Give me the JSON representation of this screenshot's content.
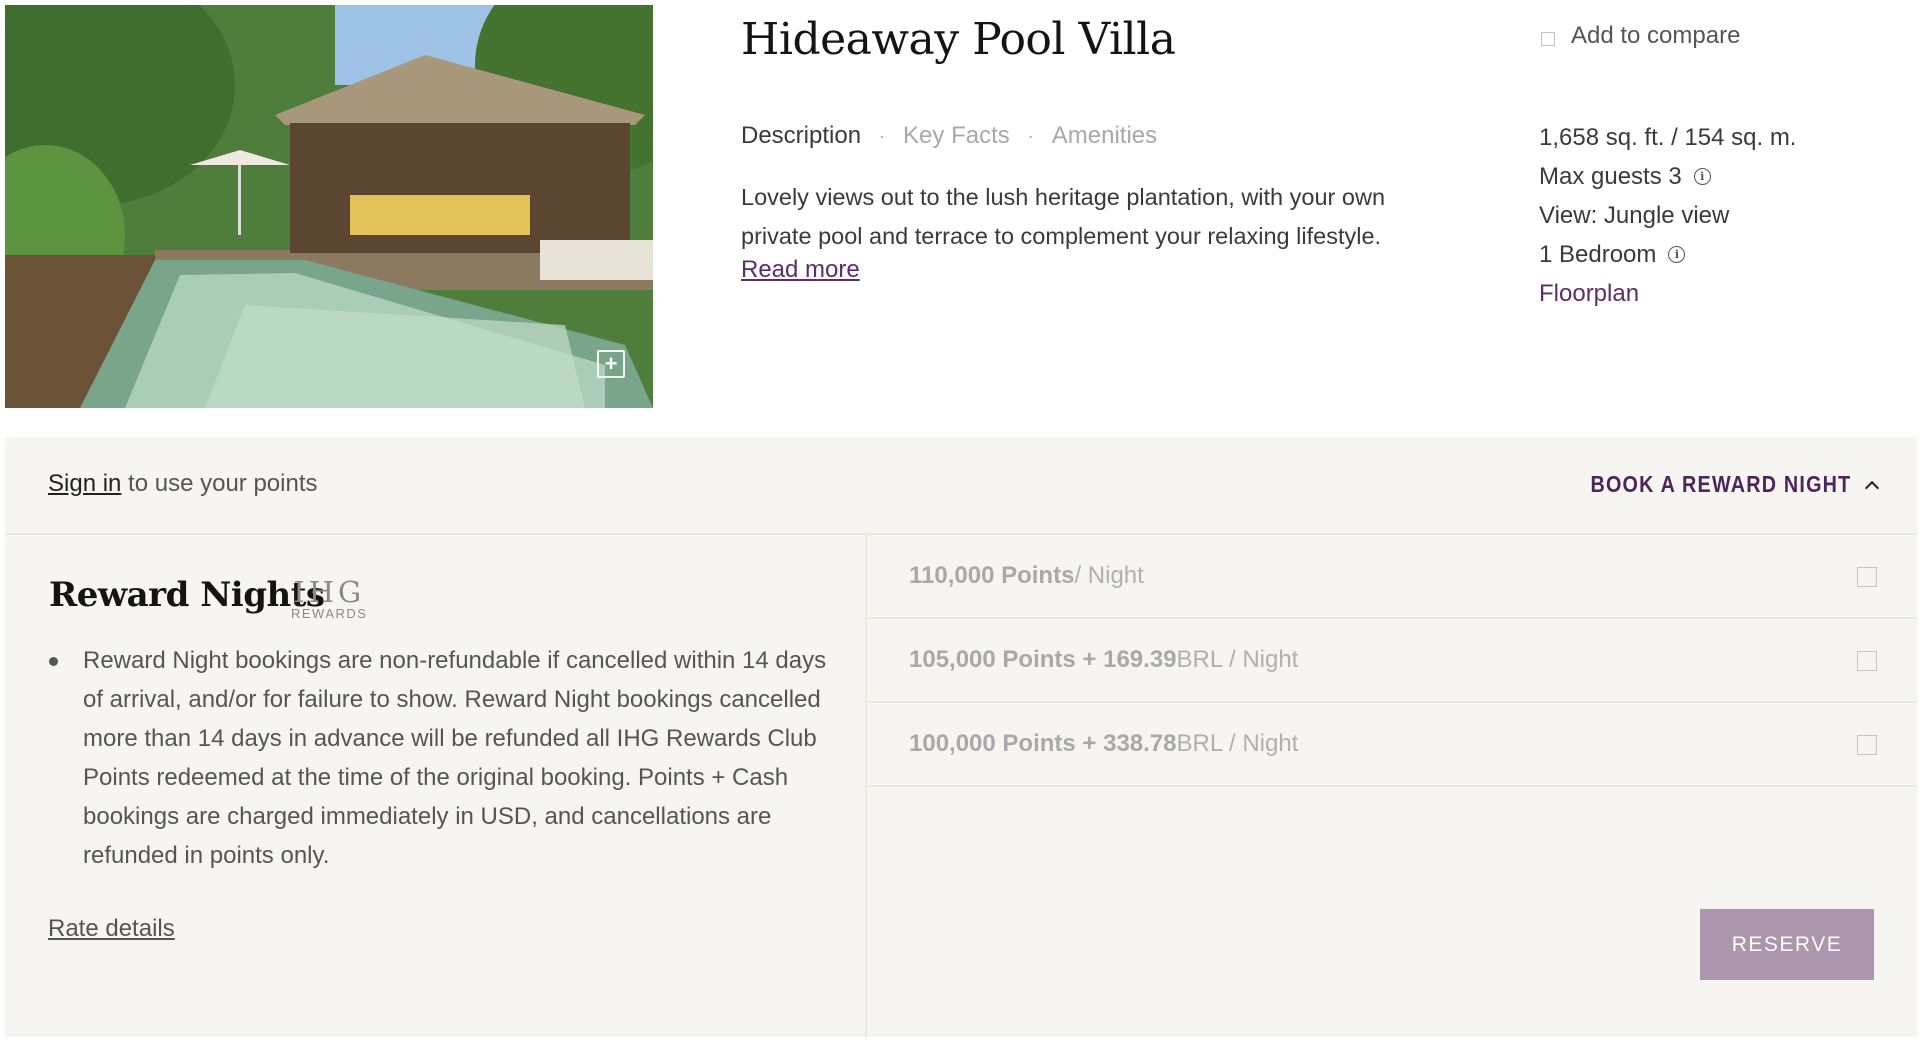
{
  "room": {
    "title": "Hideaway Pool Villa",
    "tabs": [
      {
        "label": "Description",
        "active": true
      },
      {
        "label": "Key Facts",
        "active": false
      },
      {
        "label": "Amenities",
        "active": false
      }
    ],
    "tab_separator": "·",
    "description": "Lovely views out to the lush heritage plantation, with your own private pool and terrace to complement your relaxing lifestyle.",
    "read_more_label": "Read more",
    "compare_label": "Add to compare",
    "zoom_glyph": "+",
    "facts": {
      "size": "1,658 sq. ft. / 154 sq. m.",
      "max_guests": "Max guests 3",
      "view": "View: Jungle view",
      "bedrooms": "1 Bedroom",
      "floorplan_label": "Floorplan"
    },
    "info_glyph": "i"
  },
  "panel": {
    "sign_in_link": "Sign in",
    "sign_in_suffix": " to use your points",
    "book_label": "BOOK A REWARD NIGHT",
    "reward_title": "Reward Nights",
    "logo": {
      "main": "IHG",
      "sub": "REWARDS"
    },
    "policy": "Reward Night bookings are non-refundable if cancelled within 14 days of arrival, and/or for failure to show. Reward Night bookings cancelled more than 14 days in advance will be refunded all IHG Rewards Club Points redeemed at the time of the original booking. Points + Cash bookings are charged immediately in USD, and cancellations are refunded in points only.",
    "rate_details_label": "Rate details",
    "options": [
      {
        "points": "110,000 Points",
        "suffix": " / Night",
        "checked": false
      },
      {
        "points": "105,000 Points + 169.39",
        "suffix": " BRL / Night",
        "checked": false
      },
      {
        "points": "100,000 Points + 338.78",
        "suffix": " BRL / Night",
        "checked": false
      }
    ],
    "reserve_label": "RESERVE"
  },
  "colors": {
    "accent_purple": "#5c2d6b",
    "panel_bg": "#f6f5f1",
    "reserve_bg": "#ac95ad"
  }
}
